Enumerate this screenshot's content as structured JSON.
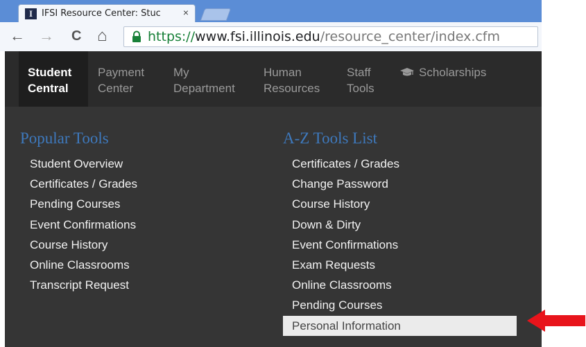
{
  "browser": {
    "tab_title": "IFSI Resource Center: Stuc",
    "favicon_letter": "I",
    "close_glyph": "×",
    "nav": {
      "back": "←",
      "forward": "→",
      "reload": "C",
      "home": "⌂"
    },
    "url": {
      "scheme": "https://",
      "host": "www.fsi.illinois.edu",
      "path": "/resource_center/index.cfm"
    }
  },
  "topnav": {
    "items": [
      {
        "line1": "Student",
        "line2": "Central",
        "active": true
      },
      {
        "line1": "Payment",
        "line2": "Center"
      },
      {
        "line1": "My",
        "line2": "Department"
      },
      {
        "line1": "Human",
        "line2": "Resources"
      },
      {
        "line1": "Staff",
        "line2": "Tools"
      },
      {
        "line1": "Scholarships",
        "line2": "",
        "icon": "graduation-cap-icon"
      }
    ]
  },
  "popular": {
    "title": "Popular Tools",
    "items": [
      "Student Overview",
      "Certificates / Grades",
      "Pending Courses",
      "Event Confirmations",
      "Course History",
      "Online Classrooms",
      "Transcript Request"
    ]
  },
  "az": {
    "title": "A-Z Tools List",
    "items": [
      "Certificates / Grades",
      "Change Password",
      "Course History",
      "Down & Dirty",
      "Event Confirmations",
      "Exam Requests",
      "Online Classrooms",
      "Pending Courses",
      "Personal Information"
    ],
    "highlighted": "Personal Information"
  },
  "colors": {
    "accent_blue": "#3e79bd",
    "arrow_red": "#e8141b",
    "tabstrip": "#5b8dd6"
  }
}
